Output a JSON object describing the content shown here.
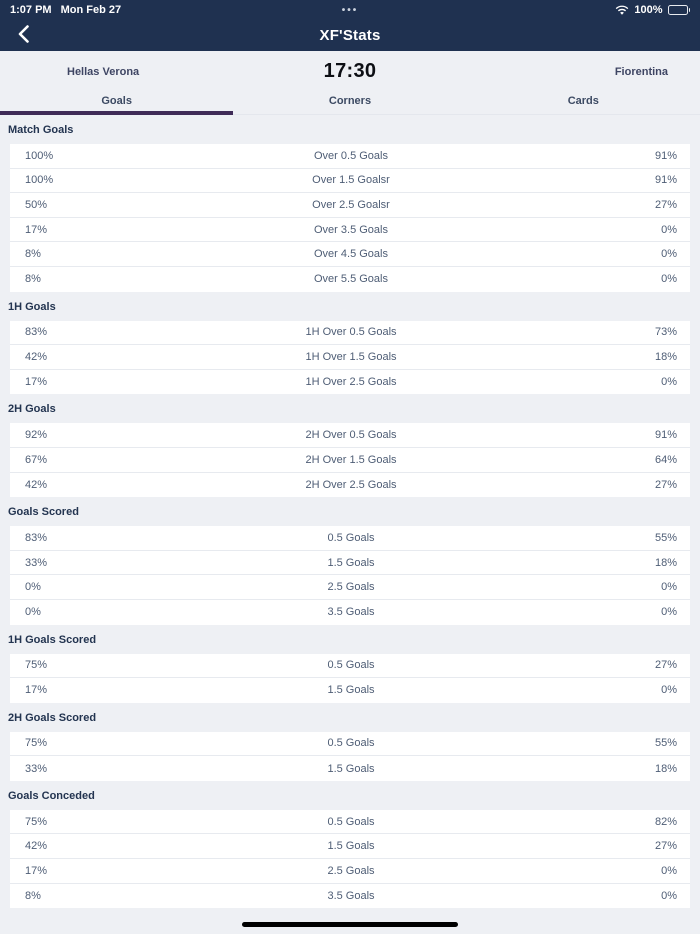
{
  "status_bar": {
    "time": "1:07 PM",
    "date": "Mon Feb 27",
    "center_dots": "•••",
    "battery_percent": "100%",
    "icons": [
      "wifi-icon",
      "battery-icon"
    ]
  },
  "nav": {
    "title": "XF'Stats",
    "back_icon": "chevron-left"
  },
  "match_header": {
    "home_team": "Hellas Verona",
    "kickoff_time": "17:30",
    "away_team": "Fiorentina"
  },
  "tabs": [
    {
      "label": "Goals",
      "active": true
    },
    {
      "label": "Corners",
      "active": false
    },
    {
      "label": "Cards",
      "active": false
    }
  ],
  "colors": {
    "navy_header": "#1f3150",
    "page_background": "#eef0f4",
    "row_background": "#ffffff",
    "active_tab_underline": "#3f2b57",
    "row_text": "#4e5d75",
    "section_title_text": "#233450"
  },
  "sections": [
    {
      "title": "Match Goals",
      "rows": [
        {
          "home": "100%",
          "label": "Over 0.5 Goals",
          "away": "91%"
        },
        {
          "home": "100%",
          "label": "Over 1.5 Goalsr",
          "away": "91%"
        },
        {
          "home": "50%",
          "label": "Over 2.5 Goalsr",
          "away": "27%"
        },
        {
          "home": "17%",
          "label": "Over 3.5 Goals",
          "away": "0%"
        },
        {
          "home": "8%",
          "label": "Over 4.5 Goals",
          "away": "0%"
        },
        {
          "home": "8%",
          "label": "Over 5.5 Goals",
          "away": "0%"
        }
      ]
    },
    {
      "title": "1H Goals",
      "rows": [
        {
          "home": "83%",
          "label": "1H Over 0.5 Goals",
          "away": "73%"
        },
        {
          "home": "42%",
          "label": "1H Over 1.5 Goals",
          "away": "18%"
        },
        {
          "home": "17%",
          "label": "1H Over 2.5 Goals",
          "away": "0%"
        }
      ]
    },
    {
      "title": "2H Goals",
      "rows": [
        {
          "home": "92%",
          "label": "2H Over 0.5 Goals",
          "away": "91%"
        },
        {
          "home": "67%",
          "label": "2H Over 1.5 Goals",
          "away": "64%"
        },
        {
          "home": "42%",
          "label": "2H Over 2.5 Goals",
          "away": "27%"
        }
      ]
    },
    {
      "title": "Goals Scored",
      "rows": [
        {
          "home": "83%",
          "label": "0.5 Goals",
          "away": "55%"
        },
        {
          "home": "33%",
          "label": "1.5 Goals",
          "away": "18%"
        },
        {
          "home": "0%",
          "label": "2.5 Goals",
          "away": "0%"
        },
        {
          "home": "0%",
          "label": "3.5 Goals",
          "away": "0%"
        }
      ]
    },
    {
      "title": "1H Goals Scored",
      "rows": [
        {
          "home": "75%",
          "label": "0.5 Goals",
          "away": "27%"
        },
        {
          "home": "17%",
          "label": "1.5 Goals",
          "away": "0%"
        }
      ]
    },
    {
      "title": "2H Goals Scored",
      "rows": [
        {
          "home": "75%",
          "label": "0.5 Goals",
          "away": "55%"
        },
        {
          "home": "33%",
          "label": "1.5 Goals",
          "away": "18%"
        }
      ]
    },
    {
      "title": "Goals Conceded",
      "rows": [
        {
          "home": "75%",
          "label": "0.5 Goals",
          "away": "82%"
        },
        {
          "home": "42%",
          "label": "1.5 Goals",
          "away": "27%"
        },
        {
          "home": "17%",
          "label": "2.5 Goals",
          "away": "0%"
        },
        {
          "home": "8%",
          "label": "3.5 Goals",
          "away": "0%"
        }
      ]
    }
  ]
}
